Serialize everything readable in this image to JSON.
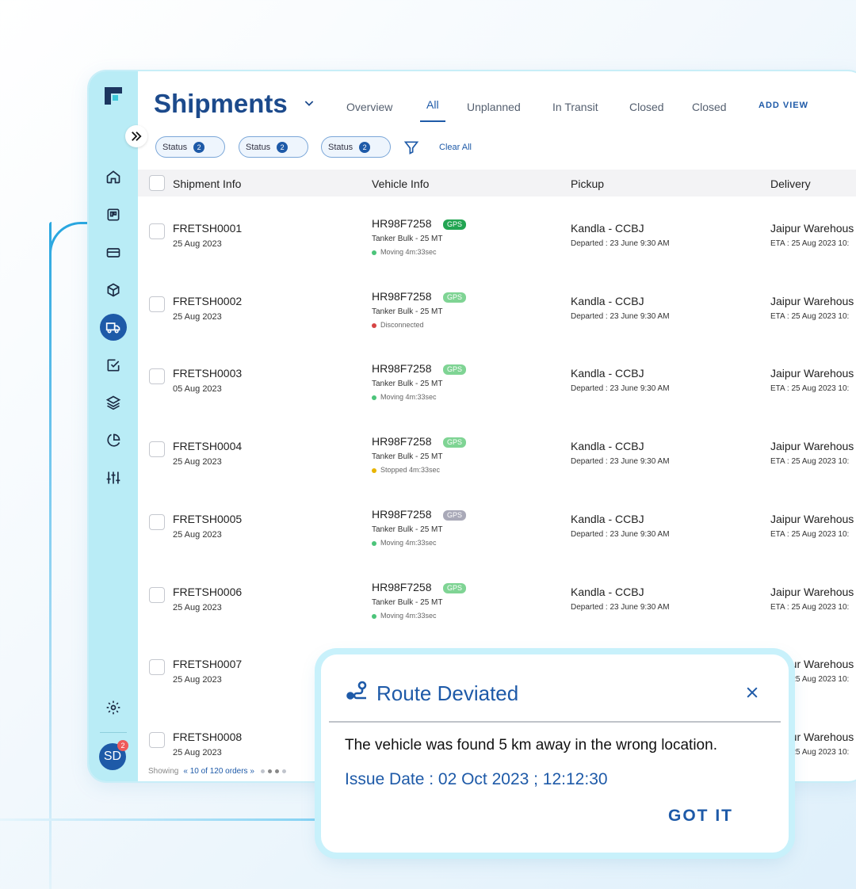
{
  "app": {
    "page_title": "Shipments",
    "expand_icon": "double-chevron-right-icon",
    "avatar_initials": "SD",
    "avatar_badge": "2"
  },
  "tabs": [
    {
      "label": "Overview"
    },
    {
      "label": "All",
      "active": true
    },
    {
      "label": "Unplanned"
    },
    {
      "label": "In Transit"
    },
    {
      "label": "Closed"
    },
    {
      "label": "Closed"
    }
  ],
  "add_view": "ADD VIEW",
  "filters": [
    {
      "label": "Status",
      "count": "2"
    },
    {
      "label": "Status",
      "count": "2"
    },
    {
      "label": "Status",
      "count": "2"
    }
  ],
  "clear_all": "Clear All",
  "table": {
    "columns": [
      "Shipment Info",
      "Vehicle Info",
      "Pickup",
      "Delivery"
    ],
    "rows": [
      {
        "id": "FRETSH0001",
        "date": "25 Aug 2023",
        "vehicle": "HR98F7258",
        "gps": "GPS",
        "type": "Tanker Bulk - 25 MT",
        "status": "Moving 4m:33sec",
        "pickup": "Kandla - CCBJ",
        "departed": "Departed : 23 June 9:30 AM",
        "delivery": "Jaipur Warehous",
        "eta": "ETA : 25 Aug 2023 10:"
      },
      {
        "id": "FRETSH0002",
        "date": "25 Aug 2023",
        "vehicle": "HR98F7258",
        "gps": "GPS",
        "type": "Tanker Bulk - 25 MT",
        "status": "Disconnected",
        "pickup": "Kandla - CCBJ",
        "departed": "Departed : 23 June 9:30 AM",
        "delivery": "Jaipur Warehous",
        "eta": "ETA : 25 Aug 2023 10:"
      },
      {
        "id": "FRETSH0003",
        "date": "05 Aug 2023",
        "vehicle": "HR98F7258",
        "gps": "GPS",
        "type": "Tanker Bulk - 25 MT",
        "status": "Moving 4m:33sec",
        "pickup": "Kandla - CCBJ",
        "departed": "Departed : 23 June 9:30 AM",
        "delivery": "Jaipur Warehous",
        "eta": "ETA : 25 Aug 2023 10:"
      },
      {
        "id": "FRETSH0004",
        "date": "25 Aug 2023",
        "vehicle": "HR98F7258",
        "gps": "GPS",
        "type": "Tanker Bulk - 25 MT",
        "status": "Stopped 4m:33sec",
        "pickup": "Kandla - CCBJ",
        "departed": "Departed : 23 June 9:30 AM",
        "delivery": "Jaipur Warehous",
        "eta": "ETA : 25 Aug 2023 10:"
      },
      {
        "id": "FRETSH0005",
        "date": "25 Aug 2023",
        "vehicle": "HR98F7258",
        "gps": "GPS",
        "type": "Tanker Bulk - 25 MT",
        "status": "Moving 4m:33sec",
        "pickup": "Kandla - CCBJ",
        "departed": "Departed : 23 June 9:30 AM",
        "delivery": "Jaipur Warehous",
        "eta": "ETA : 25 Aug 2023 10:"
      },
      {
        "id": "FRETSH0006",
        "date": "25 Aug 2023",
        "vehicle": "HR98F7258",
        "gps": "GPS",
        "type": "Tanker Bulk - 25 MT",
        "status": "Moving 4m:33sec",
        "pickup": "Kandla - CCBJ",
        "departed": "Departed : 23 June 9:30 AM",
        "delivery": "Jaipur Warehous",
        "eta": "ETA : 25 Aug 2023 10:"
      },
      {
        "id": "FRETSH0007",
        "date": "25 Aug 2023",
        "delivery": "Jaipur Warehous",
        "eta": "ETA : 25 Aug 2023 10:"
      },
      {
        "id": "FRETSH0008",
        "date": "25 Aug 2023",
        "delivery": "Jaipur Warehous",
        "eta": "ETA : 25 Aug 2023 10:"
      }
    ]
  },
  "footer": {
    "showing": "Showing",
    "orders": "10 of 120 orders"
  },
  "dialog": {
    "title": "Route Deviated",
    "message": "The vehicle was found 5 km away in the wrong location.",
    "issue_date": "Issue Date : 02 Oct 2023 ; 12:12:30",
    "action": "GOT IT"
  },
  "colors": {
    "brand": "#1e5aa8",
    "sidebar": "#b9ecf6",
    "gps_active": "#22a552",
    "gps_weak": "#7fd494",
    "gps_offline": "#a9a9b8",
    "status_moving": "#4cc47a",
    "status_disconnected": "#d64545",
    "status_stopped": "#e8b400"
  }
}
